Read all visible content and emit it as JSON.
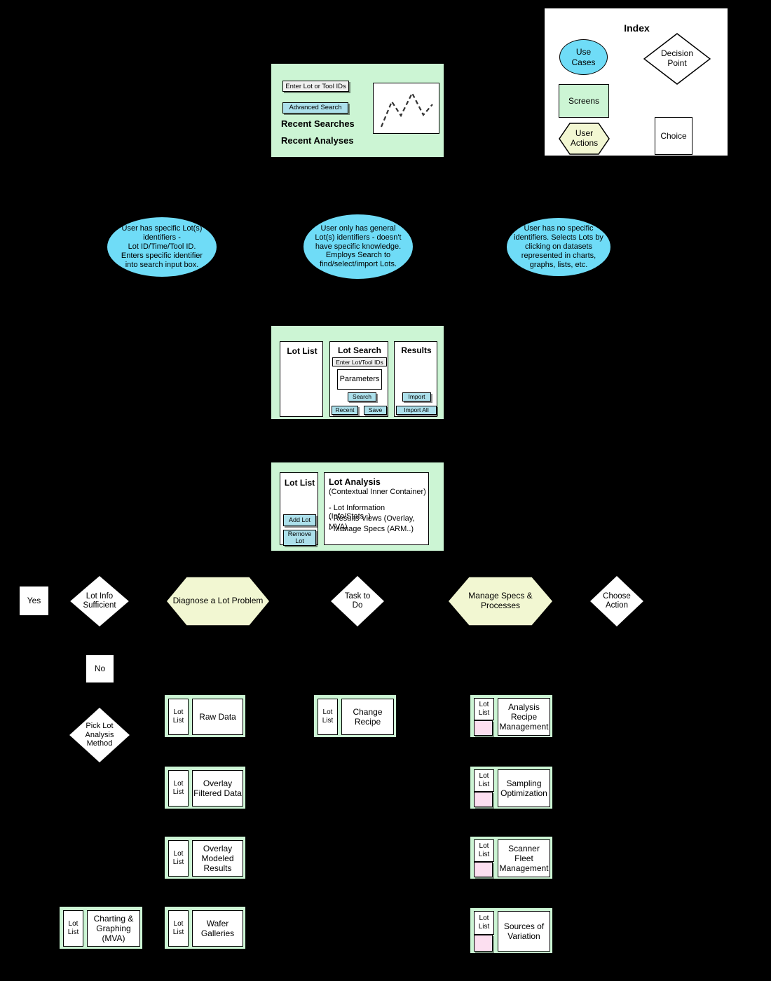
{
  "index": {
    "title": "Index",
    "legend": [
      {
        "key": "use_cases",
        "label": "Use\nCases",
        "shape": "ellipse",
        "color": "#6fdcf7"
      },
      {
        "key": "screens",
        "label": "Screens",
        "shape": "rect",
        "color": "#ccf5d4"
      },
      {
        "key": "user_actions",
        "label": "User\nActions",
        "shape": "hexagon",
        "color": "#f2f7d2"
      },
      {
        "key": "decision_point",
        "label": "Decision\nPoint",
        "shape": "diamond",
        "color": "#ffffff"
      },
      {
        "key": "choice",
        "label": "Choice",
        "shape": "square",
        "color": "#ffffff"
      }
    ]
  },
  "home_screen": {
    "search_field_placeholder": "Enter Lot or Tool IDs",
    "advanced_search_button": "Advanced Search",
    "recent_searches_label": "Recent Searches",
    "recent_analyses_label": "Recent Analyses",
    "chart_caption": "chart-thumbnail"
  },
  "use_cases": [
    {
      "id": "uc1",
      "text": "User has specific Lot(s) identifiers -\nLot ID/Time/Tool ID.\nEnters specific identifier into search input box."
    },
    {
      "id": "uc2",
      "text": "User only has general Lot(s) identifiers - doesn't have specific knowledge. Employs Search to find/select/import Lots."
    },
    {
      "id": "uc3",
      "text": "User has no specific identifiers. Selects Lots by clicking on datasets represented in charts, graphs, lists, etc."
    }
  ],
  "lot_search_screen": {
    "lot_list_title": "Lot List",
    "lot_search_title": "Lot Search",
    "enter_ids_field": "Enter Lot/Tool IDs",
    "parameters_box": "Parameters",
    "search_button": "Search",
    "recent_button": "Recent",
    "save_button": "Save",
    "results_title": "Results",
    "import_button": "Import",
    "import_all_button": "Import All"
  },
  "lot_analysis_screen": {
    "lot_list_title": "Lot List",
    "add_lot_button": "Add Lot",
    "remove_lot_button": "Remove Lot",
    "title": "Lot Analysis",
    "subtitle": "(Contextual Inner Container)",
    "bullets": [
      "- Lot Information (Info/Stats..)",
      "- Results Views (Overlay, MVA)",
      "- Manage Specs (ARM..)"
    ]
  },
  "decision_row": [
    {
      "id": "yes",
      "label": "Yes",
      "shape": "square"
    },
    {
      "id": "lot_info_sufficient",
      "label": "Lot Info\nSufficient",
      "shape": "diamond"
    },
    {
      "id": "diagnose_lot_problem",
      "label": "Diagnose a Lot Problem",
      "shape": "hexagon"
    },
    {
      "id": "task_to_do",
      "label": "Task to\nDo",
      "shape": "diamond"
    },
    {
      "id": "manage_specs_processes",
      "label": "Manage Specs &\nProcesses",
      "shape": "hexagon"
    },
    {
      "id": "choose_action",
      "label": "Choose\nAction",
      "shape": "diamond"
    }
  ],
  "no_choice": {
    "label": "No",
    "shape": "square"
  },
  "pick_method": {
    "label": "Pick Lot\nAnalysis\nMethod",
    "shape": "diamond"
  },
  "lot_list_label": "Lot List",
  "screen_cards": {
    "diagnose_column": [
      {
        "id": "raw_data",
        "label": "Raw Data",
        "has_pink": false
      },
      {
        "id": "overlay_filtered_data",
        "label": "Overlay\nFiltered Data",
        "has_pink": false
      },
      {
        "id": "overlay_modeled_results",
        "label": "Overlay\nModeled\nResults",
        "has_pink": false
      },
      {
        "id": "wafer_galleries",
        "label": "Wafer\nGalleries",
        "has_pink": false
      }
    ],
    "charting_card": {
      "id": "charting_graphing_mva",
      "label": "Charting &\nGraphing\n(MVA)",
      "has_pink": false
    },
    "task_column": [
      {
        "id": "change_recipe",
        "label": "Change\nRecipe",
        "has_pink": false
      }
    ],
    "manage_column": [
      {
        "id": "analysis_recipe_management",
        "label": "Analysis\nRecipe\nManagement",
        "has_pink": true
      },
      {
        "id": "sampling_optimization",
        "label": "Sampling\nOptimization",
        "has_pink": true
      },
      {
        "id": "scanner_fleet_management",
        "label": "Scanner\nFleet\nManagement",
        "has_pink": true
      },
      {
        "id": "sources_of_variation",
        "label": "Sources of\nVariation",
        "has_pink": true
      }
    ]
  },
  "colors": {
    "background": "#000000",
    "screen_green": "#ccf5d4",
    "use_case_blue": "#6fdcf7",
    "user_action_yellow": "#f2f7d2",
    "button_cyan": "#ace0eb",
    "pink_panel": "#fcdff0",
    "outline": "#000000"
  }
}
